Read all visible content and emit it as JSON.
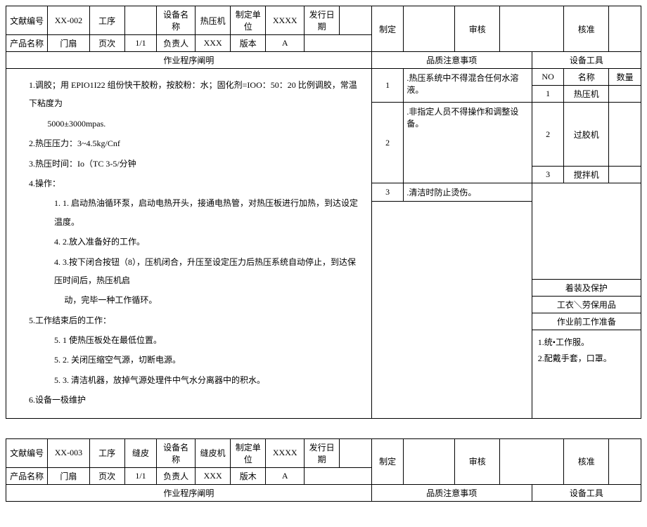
{
  "doc1": {
    "hdr": {
      "docno_l": "文献编号",
      "docno": "XX-002",
      "proc_l": "工序",
      "proc": "",
      "equip_l": "设备名称",
      "equip": "热压机",
      "unit_l": "制定单位",
      "unit": "XXXX",
      "issue_l": "发行日期",
      "issue": "",
      "make_l": "制定",
      "make": "",
      "review_l": "审核",
      "review": "",
      "approve_l": "核准",
      "approve": "",
      "prod_l": "产品名称",
      "prod": "门扇",
      "page_l": "页次",
      "page": "1/1",
      "resp_l": "负责人",
      "resp": "XXX",
      "ver_l": "版本",
      "ver": "A"
    },
    "sect": {
      "procedure": "作业程序阐明",
      "quality": "品质注意事项",
      "tools": "设备工具",
      "tool_no": "NO",
      "tool_name": "名称",
      "tool_qty": "数量",
      "cover": "着装及保护",
      "cover_txt": "工衣＼劳保用品",
      "prep": "作业前工作准备"
    },
    "proc": {
      "p1a": "1.调胶；用 EPIO1I22 组份快干胶粉，按胶粉：水；固化剂=IOO：50：20 比例调胶，常温下粘度为",
      "p1b": "5000±3000mpas.",
      "p2": "2.热压压力：3~4.5kg/Cnf",
      "p3": "3.热压时间：Io（TC    3-5/分钟",
      "p4": "4.操作：",
      "p41": "1. 1. 启动热油循环泵，启动电热开头，接通电热管，对热压板进行加热，到达设定温度。",
      "p42": "4. 2.放入准备好的工作。",
      "p43a": "4. 3.按下闭合按钮（8），压机闭合，升压至设定压力后热压系统自动停止，到达保压时间后，热压机启",
      "p43b": "动，完毕一种工作循环。",
      "p5": "5.工作结束后的工作：",
      "p51": "5. 1 使热压板处在最低位置。",
      "p52": "5. 2. 关闭压缩空气源，切断电源。",
      "p53": "5. 3. 清洁机器，放掉气源处理件中气水分离器中的积水。",
      "p6": "6.设备一极维护"
    },
    "quality": {
      "n1": "1",
      "q1": ".热压系统中不得混合任何水溶液。",
      "n2": "2",
      "q2": ".非指定人员不得操作和调整设备。",
      "n3": "3",
      "q3": ".清洁时防止烫伤。"
    },
    "tools": {
      "r1n": "1",
      "r1": "热压机",
      "r1q": "",
      "r2n": "2",
      "r2": "过胶机",
      "r2q": "",
      "r3n": "3",
      "r3": "搅拌机",
      "r3q": ""
    },
    "prep": {
      "l1": "1.统•工作服。",
      "l2": "2.配戴手套，口罩。"
    }
  },
  "doc2": {
    "hdr": {
      "docno_l": "文献编号",
      "docno": "XX-003",
      "proc_l": "工序",
      "proc": "缝皮",
      "equip_l": "设备名称",
      "equip": "缝皮机",
      "unit_l": "制定单位",
      "unit": "XXXX",
      "issue_l": "发行日期",
      "issue": "",
      "make_l": "制定",
      "make": "",
      "review_l": "审核",
      "review": "",
      "approve_l": "核准",
      "approve": "",
      "prod_l": "产品名称",
      "prod": "门扇",
      "page_l": "页次",
      "page": "1/1",
      "resp_l": "负责人",
      "resp": "XXX",
      "ver_l": "版木",
      "ver": "A"
    },
    "sect": {
      "procedure": "作业程序阐明",
      "quality": "品质注意事项",
      "tools": "设备工具"
    }
  }
}
